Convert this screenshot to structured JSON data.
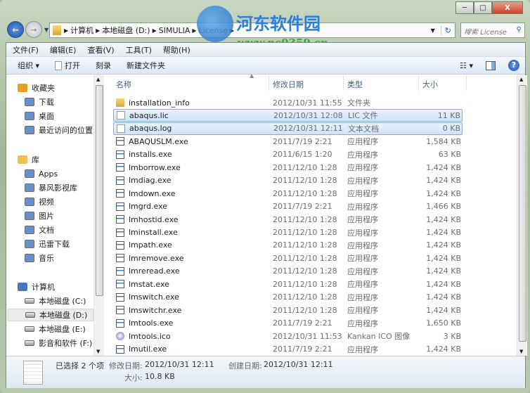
{
  "window": {
    "minimize": "─",
    "maximize": "□",
    "close": "X"
  },
  "address": {
    "segments": [
      "计算机",
      "本地磁盘 (D:)",
      "SIMULIA",
      "License"
    ],
    "search_placeholder": "搜索 License"
  },
  "watermark": {
    "title": "河东软件园",
    "url": "www.pc0359.cn"
  },
  "menu": [
    "文件(F)",
    "编辑(E)",
    "查看(V)",
    "工具(T)",
    "帮助(H)"
  ],
  "toolbar": {
    "organize": "组织 ▾",
    "open": "打开",
    "burn": "刻录",
    "new_folder": "新建文件夹"
  },
  "sidebar": {
    "favorites": {
      "label": "收藏夹",
      "items": [
        "下载",
        "桌面",
        "最近访问的位置"
      ]
    },
    "libraries": {
      "label": "库",
      "items": [
        "Apps",
        "暴风影视库",
        "视频",
        "图片",
        "文档",
        "迅雷下载",
        "音乐"
      ]
    },
    "computer": {
      "label": "计算机",
      "items": [
        "本地磁盘 (C:)",
        "本地磁盘 (D:)",
        "本地磁盘 (E:)",
        "影音和软件 (F:)"
      ],
      "selected": "本地磁盘 (D:)"
    }
  },
  "columns": [
    "名称",
    "修改日期",
    "类型",
    "大小"
  ],
  "files": [
    {
      "name": "installation_info",
      "date": "2012/10/31 11:55",
      "type": "文件夹",
      "size": "",
      "icon": "folder"
    },
    {
      "name": "abaqus.lic",
      "date": "2012/10/31 12:08",
      "type": "LIC 文件",
      "size": "11 KB",
      "icon": "doc",
      "selected": true
    },
    {
      "name": "abaqus.log",
      "date": "2012/10/31 12:11",
      "type": "文本文档",
      "size": "0 KB",
      "icon": "doc",
      "selected": true
    },
    {
      "name": "ABAQUSLM.exe",
      "date": "2011/7/19 2:21",
      "type": "应用程序",
      "size": "1,584 KB",
      "icon": "exe"
    },
    {
      "name": "installs.exe",
      "date": "2011/6/15 1:20",
      "type": "应用程序",
      "size": "63 KB",
      "icon": "exe"
    },
    {
      "name": "lmborrow.exe",
      "date": "2011/12/10 1:28",
      "type": "应用程序",
      "size": "1,424 KB",
      "icon": "exe"
    },
    {
      "name": "lmdiag.exe",
      "date": "2011/12/10 1:28",
      "type": "应用程序",
      "size": "1,424 KB",
      "icon": "exe"
    },
    {
      "name": "lmdown.exe",
      "date": "2011/12/10 1:28",
      "type": "应用程序",
      "size": "1,424 KB",
      "icon": "exe"
    },
    {
      "name": "lmgrd.exe",
      "date": "2011/7/19 2:21",
      "type": "应用程序",
      "size": "1,466 KB",
      "icon": "exe"
    },
    {
      "name": "lmhostid.exe",
      "date": "2011/12/10 1:28",
      "type": "应用程序",
      "size": "1,424 KB",
      "icon": "exe"
    },
    {
      "name": "lminstall.exe",
      "date": "2011/12/10 1:28",
      "type": "应用程序",
      "size": "1,424 KB",
      "icon": "exe"
    },
    {
      "name": "lmpath.exe",
      "date": "2011/12/10 1:28",
      "type": "应用程序",
      "size": "1,424 KB",
      "icon": "exe"
    },
    {
      "name": "lmremove.exe",
      "date": "2011/12/10 1:28",
      "type": "应用程序",
      "size": "1,424 KB",
      "icon": "exe"
    },
    {
      "name": "lmreread.exe",
      "date": "2011/12/10 1:28",
      "type": "应用程序",
      "size": "1,424 KB",
      "icon": "exe"
    },
    {
      "name": "lmstat.exe",
      "date": "2011/12/10 1:28",
      "type": "应用程序",
      "size": "1,424 KB",
      "icon": "exe"
    },
    {
      "name": "lmswitch.exe",
      "date": "2011/12/10 1:28",
      "type": "应用程序",
      "size": "1,424 KB",
      "icon": "exe"
    },
    {
      "name": "lmswitchr.exe",
      "date": "2011/12/10 1:28",
      "type": "应用程序",
      "size": "1,424 KB",
      "icon": "exe"
    },
    {
      "name": "lmtools.exe",
      "date": "2011/7/19 2:21",
      "type": "应用程序",
      "size": "1,650 KB",
      "icon": "exe"
    },
    {
      "name": "lmtools.ico",
      "date": "2012/10/31 11:53",
      "type": "Kankan ICO 图像",
      "size": "3 KB",
      "icon": "ico"
    },
    {
      "name": "lmutil.exe",
      "date": "2011/7/19 2:21",
      "type": "应用程序",
      "size": "1,424 KB",
      "icon": "exe"
    }
  ],
  "status": {
    "selected": "已选择 2 个项",
    "modified_label": "修改日期:",
    "modified": "2012/10/31 12:11",
    "created_label": "创建日期:",
    "created": "2012/10/31 12:11",
    "size_label": "大小:",
    "size": "10.8 KB"
  }
}
